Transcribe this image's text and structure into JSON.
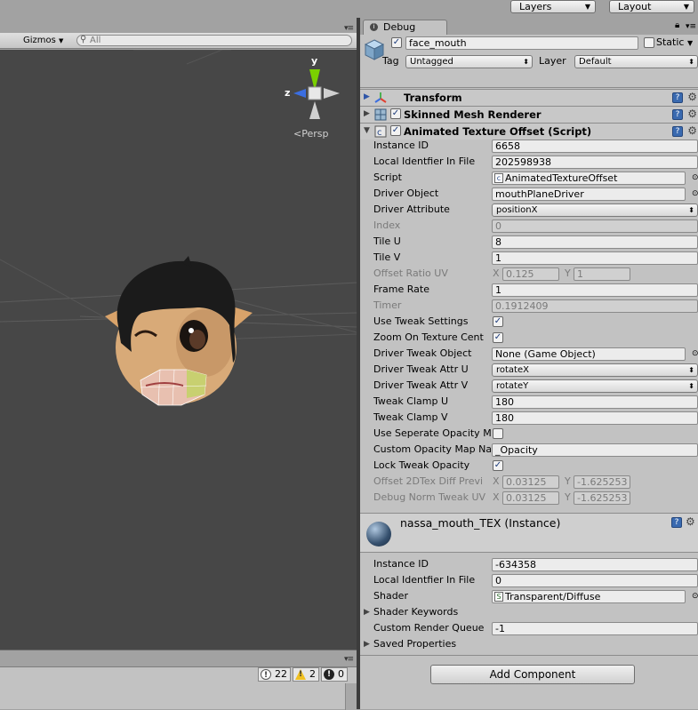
{
  "topbar": {
    "layers_label": "Layers",
    "layout_label": "Layout"
  },
  "scene": {
    "gizmos_label": "Gizmos",
    "search_placeholder": "All",
    "persp_label": "Persp",
    "axis_y": "y",
    "axis_z": "z"
  },
  "console": {
    "log_count": "22",
    "warning_count": "2",
    "error_count": "0"
  },
  "inspector": {
    "tab_label": "Debug",
    "object_name": "face_mouth",
    "static_label": "Static",
    "tag_label": "Tag",
    "tag_value": "Untagged",
    "layer_label": "Layer",
    "layer_value": "Default",
    "components": {
      "transform": "Transform",
      "skinned_mesh": "Skinned Mesh Renderer",
      "animated_texture": "Animated Texture Offset (Script)"
    },
    "fields": {
      "instance_id_label": "Instance ID",
      "instance_id_value": "6658",
      "local_id_label": "Local Identfier In File",
      "local_id_value": "202598938",
      "script_label": "Script",
      "script_value": "AnimatedTextureOffset",
      "driver_object_label": "Driver Object",
      "driver_object_value": "mouthPlaneDriver",
      "driver_attribute_label": "Driver Attribute",
      "driver_attribute_value": "positionX",
      "index_label": "Index",
      "index_value": "0",
      "tile_u_label": "Tile U",
      "tile_u_value": "8",
      "tile_v_label": "Tile V",
      "tile_v_value": "1",
      "offset_ratio_label": "Offset Ratio UV",
      "offset_ratio_x": "0.125",
      "offset_ratio_y": "1",
      "frame_rate_label": "Frame Rate",
      "frame_rate_value": "1",
      "timer_label": "Timer",
      "timer_value": "0.1912409",
      "use_tweak_label": "Use Tweak Settings",
      "zoom_label": "Zoom On Texture Cent",
      "tweak_object_label": "Driver Tweak Object",
      "tweak_object_value": "None (Game Object)",
      "tweak_attr_u_label": "Driver Tweak Attr U",
      "tweak_attr_u_value": "rotateX",
      "tweak_attr_v_label": "Driver Tweak Attr V",
      "tweak_attr_v_value": "rotateY",
      "clamp_u_label": "Tweak Clamp U",
      "clamp_u_value": "180",
      "clamp_v_label": "Tweak Clamp V",
      "clamp_v_value": "180",
      "seperate_opacity_label": "Use Seperate Opacity M",
      "custom_opacity_label": "Custom Opacity Map Na",
      "custom_opacity_value": "_Opacity",
      "lock_tweak_label": "Lock Tweak Opacity",
      "offset2d_label": "Offset 2DTex Diff Previ",
      "offset2d_x": "0.03125",
      "offset2d_y": "-1.625253",
      "debug_norm_label": "Debug Norm Tweak UV",
      "debug_norm_x": "0.03125",
      "debug_norm_y": "-1.625253",
      "x_label": "X",
      "y_label": "Y"
    },
    "material": {
      "name": "nassa_mouth_TEX (Instance)",
      "instance_id_label": "Instance ID",
      "instance_id_value": "-634358",
      "local_id_label": "Local Identfier In File",
      "local_id_value": "0",
      "shader_label": "Shader",
      "shader_value": "Transparent/Diffuse",
      "shader_keywords_label": "Shader Keywords",
      "render_queue_label": "Custom Render Queue",
      "render_queue_value": "-1",
      "saved_props_label": "Saved Properties"
    },
    "add_component_label": "Add Component"
  }
}
